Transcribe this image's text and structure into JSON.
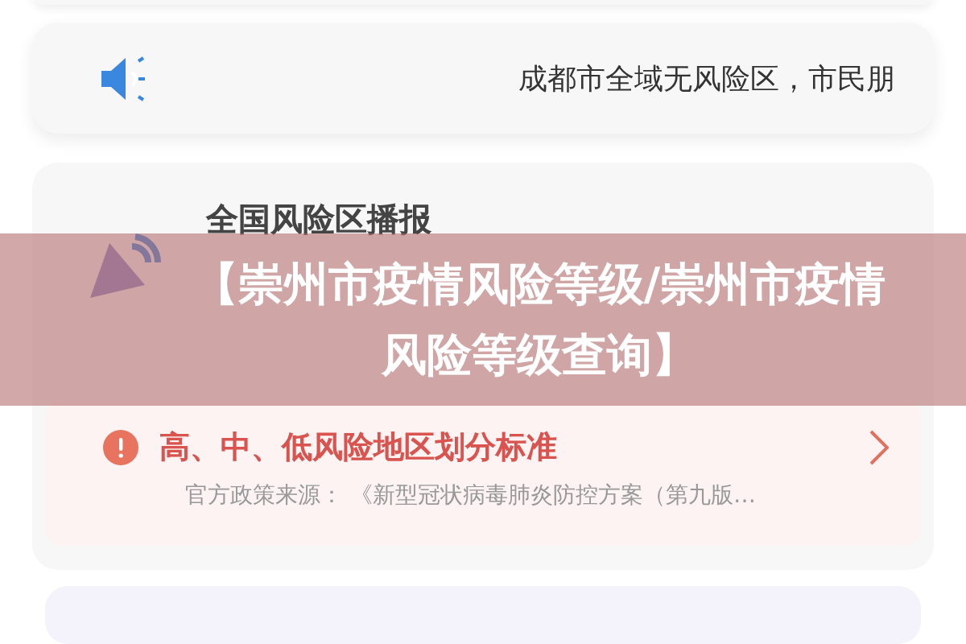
{
  "notice": {
    "text": "成都市全域无风险区，市民朋"
  },
  "broadcast": {
    "title": "全国风险区播报"
  },
  "standard": {
    "title": "高、中、低风险地区划分标准",
    "source": "官方政策来源： 《新型冠状病毒肺炎防控方案（第九版…"
  },
  "overlay_title": {
    "text": "【崇州市疫情风险等级/崇州市疫情风险等级查询】"
  }
}
